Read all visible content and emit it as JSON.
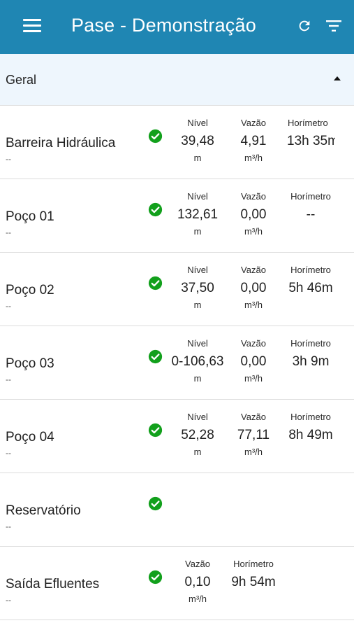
{
  "appbar": {
    "title": "Pase - Demonstração",
    "menu_icon": "menu-icon",
    "refresh_icon": "refresh-icon",
    "filter_icon": "filter-icon",
    "background": "#1f86b3"
  },
  "group": {
    "label": "Geral",
    "expanded": true
  },
  "status_color": "#12a01c",
  "rows": [
    {
      "name": "Barreira Hidráulica",
      "sub": "--",
      "metrics": [
        {
          "label": "Nível",
          "value": "39,48",
          "unit": "m"
        },
        {
          "label": "Vazão",
          "value": "4,91",
          "unit": "m³/h"
        },
        {
          "label": "Horímetro",
          "value": "13h 35m",
          "unit": ""
        }
      ]
    },
    {
      "name": "Poço 01",
      "sub": "--",
      "metrics": [
        {
          "label": "Nível",
          "value": "132,61",
          "unit": "m"
        },
        {
          "label": "Vazão",
          "value": "0,00",
          "unit": "m³/h"
        },
        {
          "label": "Horímetro",
          "value": "--",
          "unit": ""
        }
      ]
    },
    {
      "name": "Poço 02",
      "sub": "--",
      "metrics": [
        {
          "label": "Nível",
          "value": "37,50",
          "unit": "m"
        },
        {
          "label": "Vazão",
          "value": "0,00",
          "unit": "m³/h"
        },
        {
          "label": "Horímetro",
          "value": "5h 46m",
          "unit": ""
        }
      ]
    },
    {
      "name": "Poço 03",
      "sub": "--",
      "metrics": [
        {
          "label": "Nível",
          "value": "0-106,63",
          "unit": "m"
        },
        {
          "label": "Vazão",
          "value": "0,00",
          "unit": "m³/h"
        },
        {
          "label": "Horímetro",
          "value": "3h 9m",
          "unit": ""
        }
      ]
    },
    {
      "name": "Poço 04",
      "sub": "--",
      "metrics": [
        {
          "label": "Nível",
          "value": "52,28",
          "unit": "m"
        },
        {
          "label": "Vazão",
          "value": "77,11",
          "unit": "m³/h"
        },
        {
          "label": "Horímetro",
          "value": "8h 49m",
          "unit": ""
        }
      ]
    },
    {
      "name": "Reservatório",
      "sub": "--",
      "metrics": []
    },
    {
      "name": "Saída Efluentes",
      "sub": "--",
      "metrics": [
        {
          "label": "Vazão",
          "value": "0,10",
          "unit": "m³/h"
        },
        {
          "label": "Horímetro",
          "value": "9h 54m",
          "unit": ""
        }
      ]
    }
  ]
}
